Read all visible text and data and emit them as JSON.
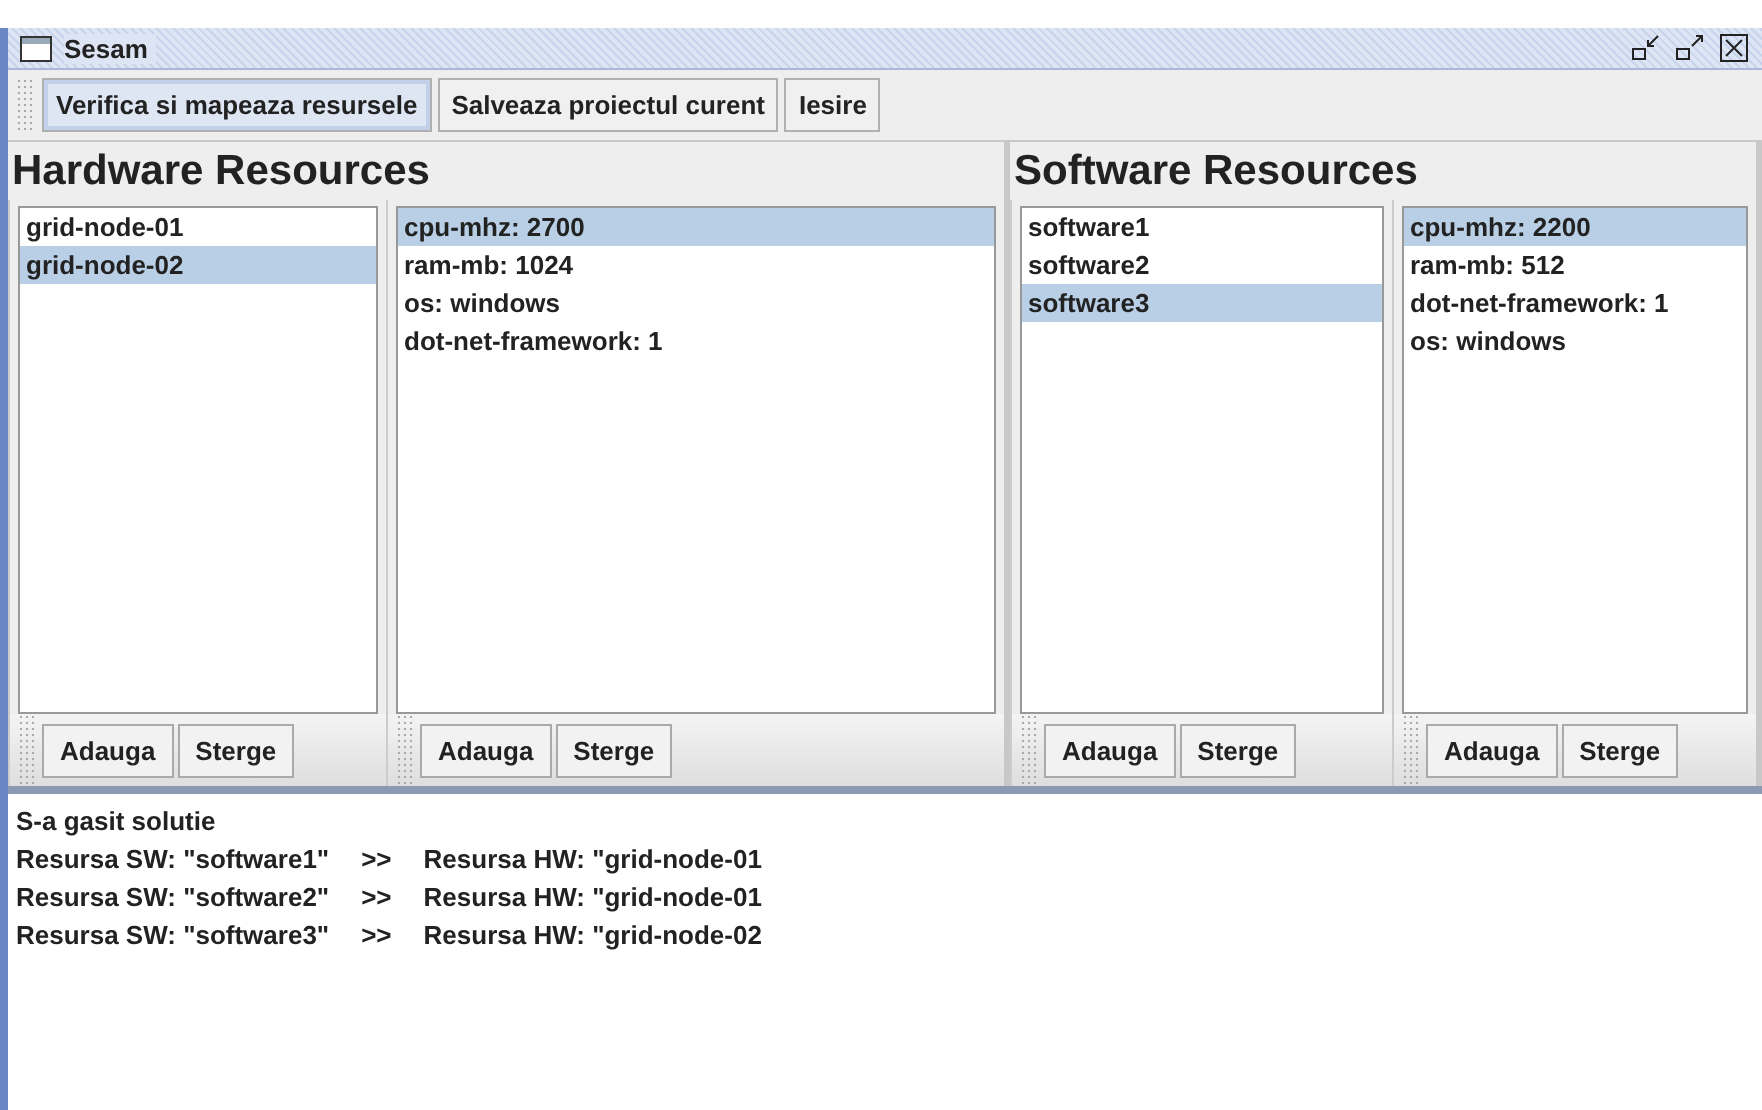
{
  "window": {
    "title": "Sesam"
  },
  "toolbar": [
    {
      "label": "Verifica si mapeaza resursele",
      "selected": true
    },
    {
      "label": "Salveaza proiectul curent",
      "selected": false
    },
    {
      "label": "Iesire",
      "selected": false
    }
  ],
  "panels": [
    {
      "title": "Hardware Resources",
      "lists": [
        {
          "items": [
            {
              "label": "grid-node-01",
              "selected": false
            },
            {
              "label": "grid-node-02",
              "selected": true
            }
          ],
          "buttons": [
            "Adauga",
            "Sterge"
          ]
        },
        {
          "items": [
            {
              "label": "cpu-mhz: 2700",
              "selected": true
            },
            {
              "label": "ram-mb: 1024",
              "selected": false
            },
            {
              "label": "os: windows",
              "selected": false
            },
            {
              "label": "dot-net-framework: 1",
              "selected": false
            }
          ],
          "buttons": [
            "Adauga",
            "Sterge"
          ]
        }
      ]
    },
    {
      "title": "Software Resources",
      "lists": [
        {
          "items": [
            {
              "label": "software1",
              "selected": false
            },
            {
              "label": "software2",
              "selected": false
            },
            {
              "label": "software3",
              "selected": true
            }
          ],
          "buttons": [
            "Adauga",
            "Sterge"
          ]
        },
        {
          "items": [
            {
              "label": "cpu-mhz: 2200",
              "selected": true
            },
            {
              "label": "ram-mb: 512",
              "selected": false
            },
            {
              "label": "dot-net-framework: 1",
              "selected": false
            },
            {
              "label": "os: windows",
              "selected": false
            }
          ],
          "buttons": [
            "Adauga",
            "Sterge"
          ]
        }
      ]
    }
  ],
  "output": {
    "heading": "S-a gasit solutie",
    "rows": [
      {
        "software": "Resursa SW: \"software1\"",
        "arrow": ">>",
        "hardware": "Resursa HW: \"grid-node-01"
      },
      {
        "software": "Resursa SW: \"software2\"",
        "arrow": ">>",
        "hardware": "Resursa HW: \"grid-node-01"
      },
      {
        "software": "Resursa SW: \"software3\"",
        "arrow": ">>",
        "hardware": "Resursa HW: \"grid-node-02"
      }
    ]
  }
}
